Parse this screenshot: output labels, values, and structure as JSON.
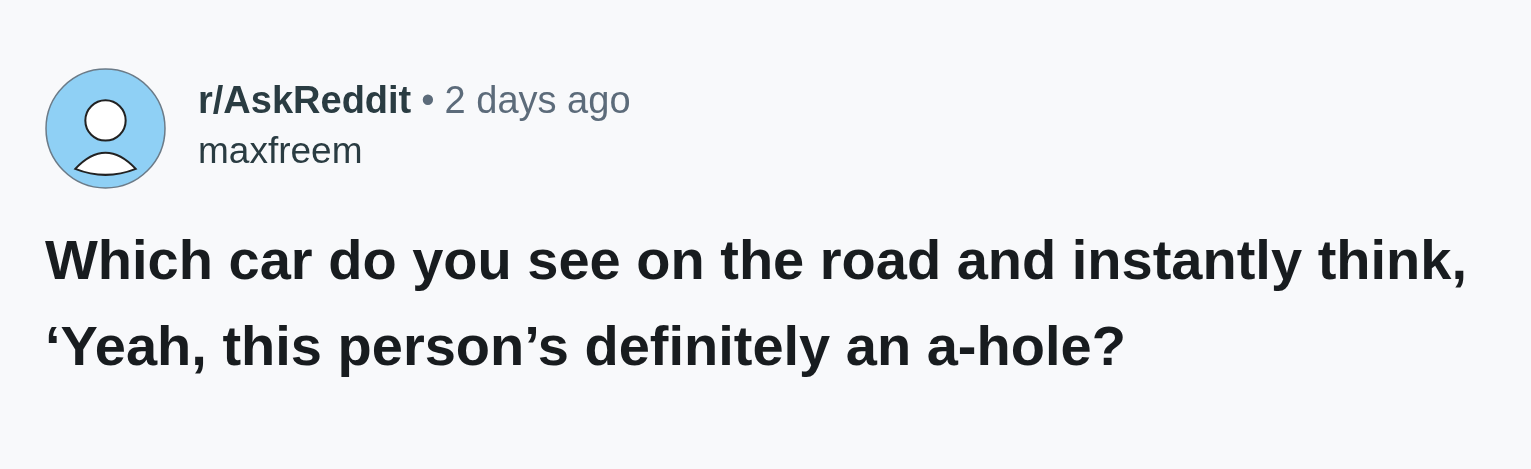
{
  "post": {
    "subreddit": "r/AskReddit",
    "separator": "•",
    "time": "2 days ago",
    "author": "maxfreem",
    "title": "Which car do you see on the road and instantly think, ‘Yeah, this person’s definitely an a-hole?"
  }
}
